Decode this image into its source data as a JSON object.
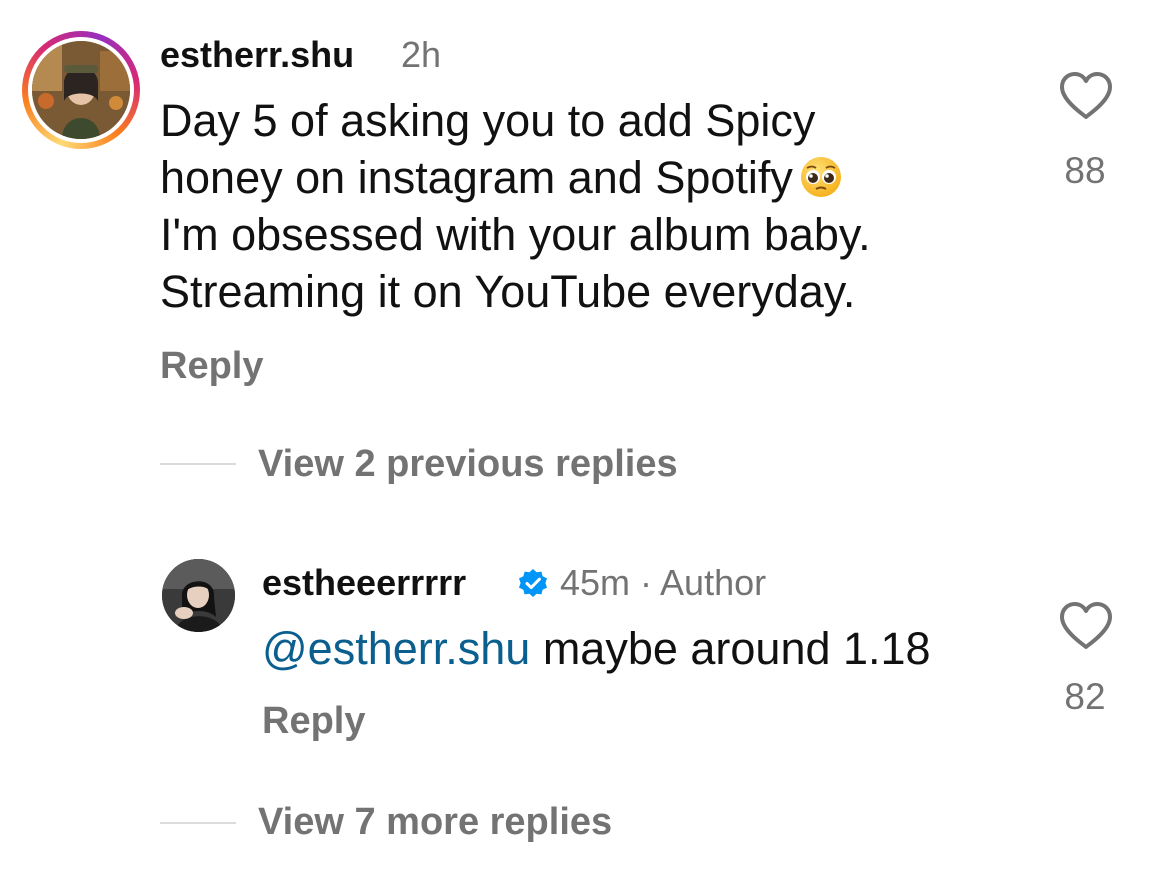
{
  "colors": {
    "text_primary": "#111111",
    "text_secondary": "#737373",
    "mention": "#0b5f8f",
    "verified_badge": "#0095f6",
    "story_ring": [
      "#feda75",
      "#fa7e1e",
      "#d62976",
      "#962fbf"
    ]
  },
  "comment": {
    "username": "estherr.shu",
    "time": "2h",
    "text_lines": [
      "Day 5 of asking you to add Spicy",
      "honey on instagram and Spotify",
      "I'm obsessed with your album baby.",
      "Streaming it on YouTube everyday."
    ],
    "emoji": "pleading-face-emoji",
    "reply_label": "Reply",
    "like_icon": "heart-outline-icon",
    "like_count": "88"
  },
  "view_previous_label": "View 2 previous replies",
  "reply": {
    "username": "estheeerrrrr",
    "verified_icon": "verified-badge-icon",
    "meta": "45m · Author",
    "mention": "@estherr.shu",
    "text": " maybe around 1.18",
    "reply_label": "Reply",
    "like_icon": "heart-outline-icon",
    "like_count": "82"
  },
  "view_more_label": "View 7 more replies"
}
